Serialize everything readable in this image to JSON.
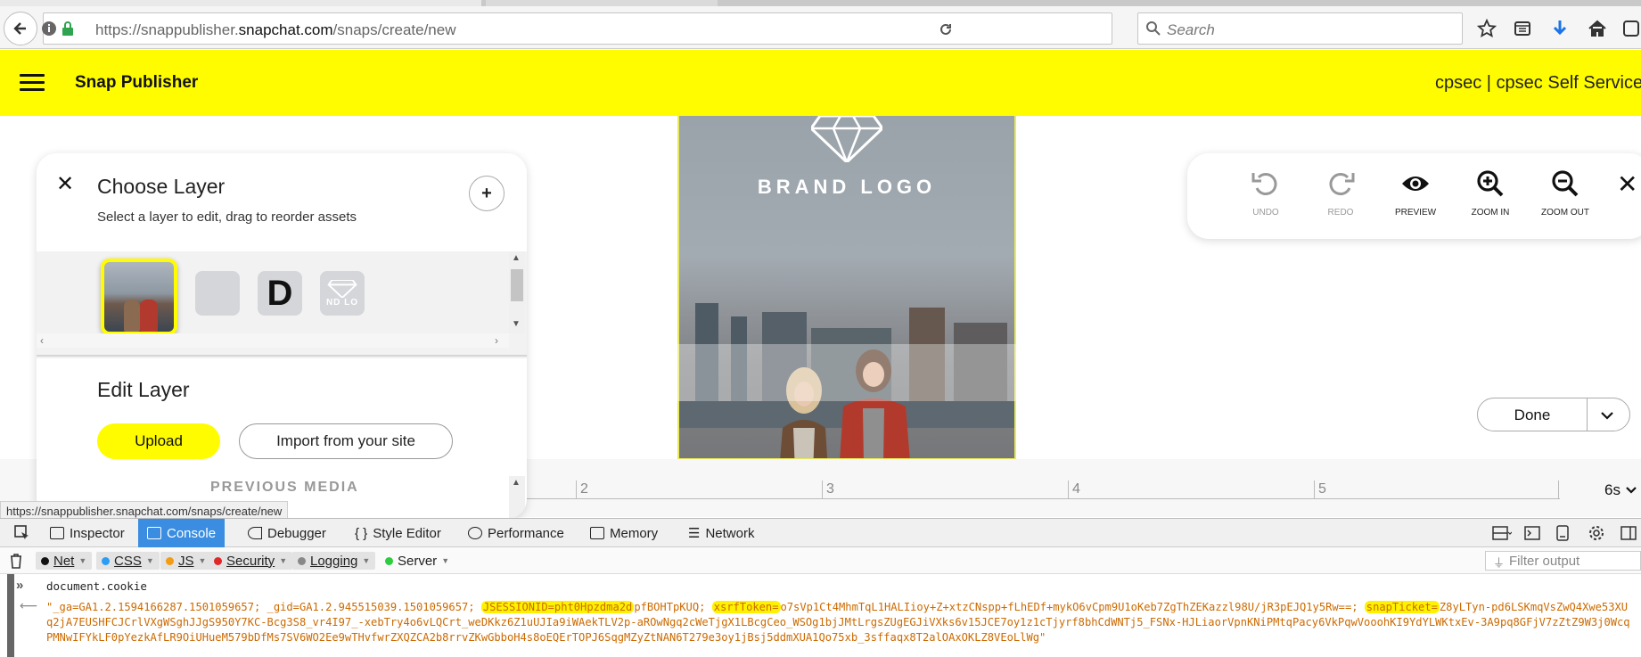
{
  "browser": {
    "url_prefix": "https://snappublisher.",
    "url_host": "snapchat.com",
    "url_path": "/snaps/create/new",
    "search_placeholder": "Search",
    "status_url": "https://snappublisher.snapchat.com/snaps/create/new"
  },
  "header": {
    "app_title": "Snap Publisher",
    "account": "cpsec | cpsec Self Service"
  },
  "layer_panel": {
    "title": "Choose Layer",
    "subtitle": "Select a layer to edit, drag to reorder assets",
    "text_layer_letter": "D",
    "logo_thumb_text": "ND LO",
    "edit_title": "Edit Layer",
    "upload_label": "Upload",
    "import_label": "Import from your site",
    "previous_media": "PREVIOUS MEDIA"
  },
  "preview": {
    "brand_logo": "BRAND LOGO"
  },
  "toolbar": {
    "undo": "UNDO",
    "redo": "REDO",
    "preview": "PREVIEW",
    "zoom_in": "ZOOM IN",
    "zoom_out": "ZOOM OUT"
  },
  "done_label": "Done",
  "timeline": {
    "ticks": [
      "2",
      "3",
      "4",
      "5"
    ],
    "duration": "6s"
  },
  "devtools": {
    "tabs": {
      "inspector": "Inspector",
      "console": "Console",
      "debugger": "Debugger",
      "style_editor": "Style Editor",
      "performance": "Performance",
      "memory": "Memory",
      "network": "Network"
    },
    "filters": {
      "net": "Net",
      "css": "CSS",
      "js": "JS",
      "security": "Security",
      "logging": "Logging",
      "server": "Server"
    },
    "filter_colors": {
      "net": "#111111",
      "css": "#2a9df4",
      "js": "#f39c12",
      "security": "#e02828",
      "logging": "#888888",
      "server": "#2ecc40"
    },
    "filter_output_placeholder": "Filter output",
    "command": "document.cookie",
    "output": {
      "part1": "\"_ga=GA1.2.1594166287.1501059657; _gid=GA1.2.945515039.1501059657; ",
      "jsession": "JSESSIONID=pht0Hpzdma2d",
      "part2": "pfBOHTpKUQ; ",
      "xsrf": "xsrfToken=",
      "part3": "o7sVp1Ct4MhmTqL1HALIioy+Z+xtzCNspp+fLhEDf+mykO6vCpm9U1oKeb7ZgThZEKazzl98U/jR3pEJQ1y5Rw==; ",
      "ticket": "snapTicket=",
      "part4": "Z8yLTyn-pd6LSKmqVsZwQ4Xwe53XUq2jA7EUSHFCJCrlVXgWSghJJgS950Y7KC-Bcg3S8_vr4I97_-xebTry4o6vLQCrt_weDKkz6Z1uUJIa9iWAekTLV2p-aROwNgq2cWeTjgX1LBcgCeo_WSOg1bjJMtLrgsZUgEGJiVXks6v15JCE7oy1z1cTjyrf8bhCdWNTj5_FSNx-HJLiaorVpnKNiPMtqPacy6VkPqwVooohKI9YdYLWKtxEv-3A9pq8GFjV7zZtZ9W3j0WcqPMNwIFYkLF0pYezkAfLR9OiUHueM579bDfMs7SV6WO2Ee9wTHvfwrZXQZCA2b8rrvZKwGbboH4s8oEQErTOPJ6SqgMZyZtNAN6T279e3oy1jBsj5ddmXUA1Qo75xb_3sffaqx8T2alOAxOKLZ8VEoLlWg\""
    }
  }
}
